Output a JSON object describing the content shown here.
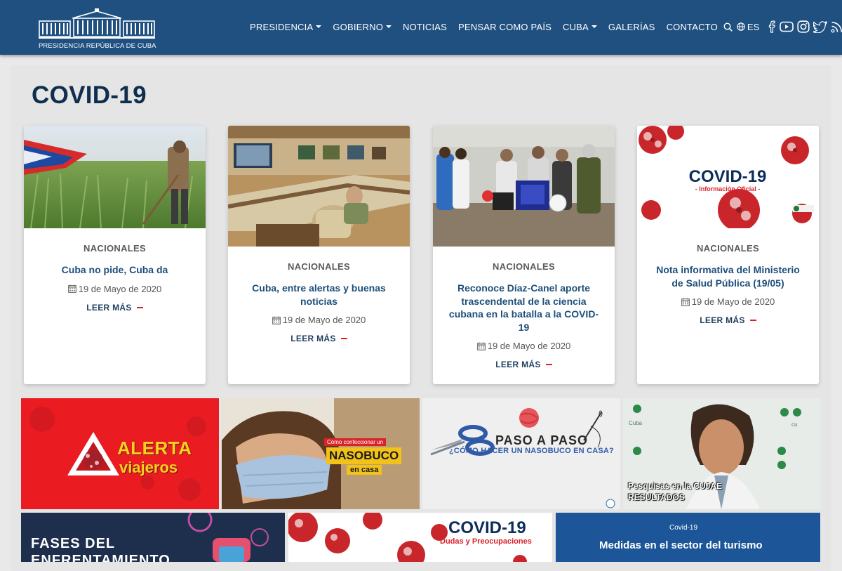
{
  "site": {
    "logo_text": "PRESIDENCIA REPÚBLICA DE CUBA"
  },
  "nav": {
    "items": [
      {
        "label": "PRESIDENCIA",
        "dropdown": true
      },
      {
        "label": "GOBIERNO",
        "dropdown": true
      },
      {
        "label": "NOTICIAS",
        "dropdown": false
      },
      {
        "label": "PENSAR COMO PAÍS",
        "dropdown": false
      },
      {
        "label": "CUBA",
        "dropdown": true
      },
      {
        "label": "GALERÍAS",
        "dropdown": false
      },
      {
        "label": "CONTACTO",
        "dropdown": false
      }
    ],
    "search_icon": "search-icon",
    "language": "ES",
    "social_icons": [
      "facebook-icon",
      "youtube-icon",
      "instagram-icon",
      "twitter-icon",
      "rss-icon"
    ]
  },
  "page": {
    "title": "COVID-19"
  },
  "cards": [
    {
      "category": "NACIONALES",
      "title": "Cuba no pide, Cuba da",
      "date": "19 de Mayo de 2020",
      "more": "LEER MÁS",
      "image": "farmer-cane-field-cuban-flag"
    },
    {
      "category": "NACIONALES",
      "title": "Cuba, entre alertas y buenas noticias",
      "date": "19 de Mayo de 2020",
      "more": "LEER MÁS",
      "image": "government-meeting-room"
    },
    {
      "category": "NACIONALES",
      "title": "Reconoce Díaz-Canel aporte trascendental de la ciencia cubana en la batalla a la COVID-19",
      "date": "19 de Mayo de 2020",
      "more": "LEER MÁS",
      "image": "scientists-lab-visit"
    },
    {
      "category": "NACIONALES",
      "title": "Nota informativa del Ministerio de Salud Pública (19/05)",
      "date": "19 de Mayo de 2020",
      "more": "LEER MÁS",
      "image": "covid-19-official-info-graphic",
      "image_title": "COVID-19",
      "image_subtitle": "- Información Oficial -"
    }
  ],
  "tiles_row1": [
    {
      "line1": "ALERTA",
      "line2": "viajeros",
      "bg": "#ea1c22"
    },
    {
      "caption_top": "Cómo confeccionar un",
      "caption_main": "NASOBUCO",
      "caption_bottom": "en casa",
      "bg": "#c9a27f"
    },
    {
      "title": "PASO A PASO",
      "subtitle": "¿CÓMO HACER UN NASOBUCO EN CASA?",
      "bg": "#efefef"
    },
    {
      "line1": "Pesquisas en la CUJAE",
      "line2": "RESULTADOS",
      "bg": "#dfe8e1"
    }
  ],
  "tiles_row2": [
    {
      "title": "FASES DEL ENFRENTAMIENTO",
      "bg": "#1d2f4c"
    },
    {
      "title": "COVID-19",
      "subtitle": "Dudas y Preocupaciones",
      "bg": "#ffffff"
    },
    {
      "small": "Covid-19",
      "title": "Medidas en el sector del turismo",
      "bg": "#1c5698"
    }
  ],
  "colors": {
    "navbar": "#1f5080",
    "title": "#0f2e4e",
    "link": "#1d4f7a",
    "accent_red": "#d9222a"
  }
}
